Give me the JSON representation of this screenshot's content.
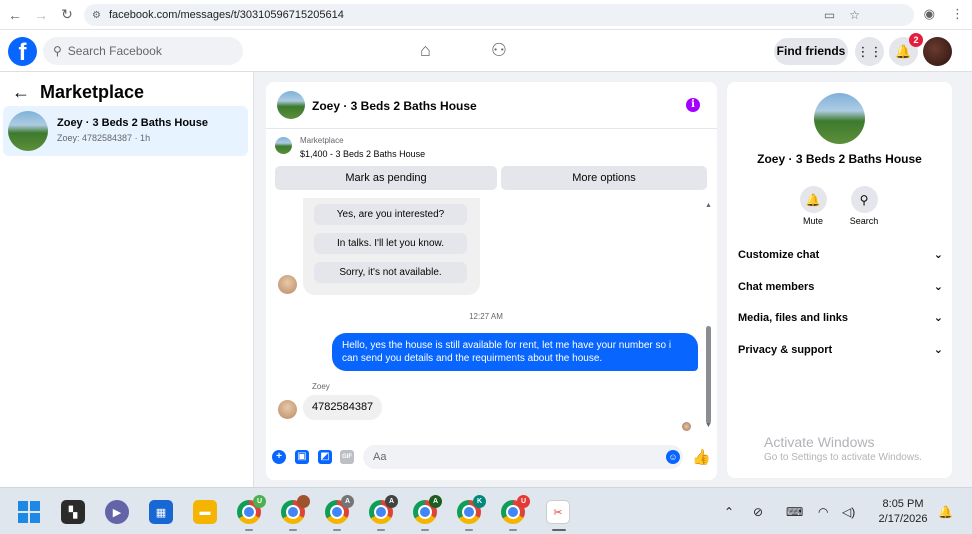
{
  "browser": {
    "url": "facebook.com/messages/t/30310596715205614"
  },
  "header": {
    "search_placeholder": "Search Facebook",
    "find_friends": "Find friends",
    "notification_count": "2"
  },
  "left_panel": {
    "title": "Marketplace",
    "conversation": {
      "title": "Zoey · 3 Beds 2 Baths House",
      "subtitle": "Zoey: 4782584387 · 1h"
    }
  },
  "chat": {
    "title": "Zoey · 3 Beds 2 Baths House",
    "marketplace_label": "Marketplace",
    "listing": "$1,400 - 3 Beds 2 Baths House",
    "mark_pending": "Mark as pending",
    "more_options": "More options",
    "quick_replies": [
      "Yes, are you interested?",
      "In talks. I'll let you know.",
      "Sorry, it's not available."
    ],
    "timestamp": "12:27 AM",
    "outgoing_message": "Hello, yes the house is still available for rent, let me have your number so i can send you details and the requirments about the house.",
    "sender_name": "Zoey",
    "incoming_message": "4782584387",
    "composer_placeholder": "Aa"
  },
  "right_panel": {
    "title": "Zoey · 3 Beds 2 Baths House",
    "mute": "Mute",
    "search": "Search",
    "rows": [
      "Customize chat",
      "Chat members",
      "Media, files and links",
      "Privacy & support"
    ]
  },
  "watermark": {
    "title": "Activate Windows",
    "subtitle": "Go to Settings to activate Windows."
  },
  "taskbar": {
    "profile_badges": [
      "U",
      "",
      "A",
      "A",
      "A",
      "K",
      "U"
    ],
    "time": "8:05 PM",
    "date": "2/17/2026"
  }
}
